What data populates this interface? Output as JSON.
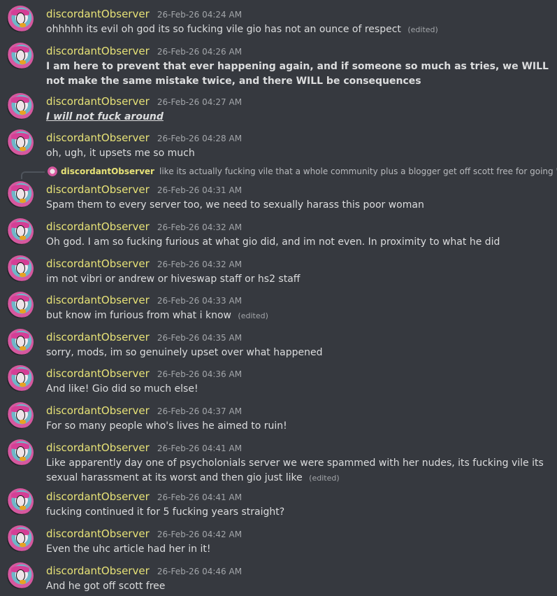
{
  "messages": [
    {
      "author": "discordantObserver",
      "time": "26-Feb-26 04:24 AM",
      "text": "ohhhhh its evil oh god its so fucking vile gio has  not an ounce of respect",
      "edited": "(edited)"
    },
    {
      "author": "discordantObserver",
      "time": "26-Feb-26 04:26 AM",
      "text": " I am here to prevent that ever happening again, and if someone so much as tries, we WILL not make the same mistake twice, and there WILL be consequences",
      "style": "bold"
    },
    {
      "author": "discordantObserver",
      "time": "26-Feb-26 04:27 AM",
      "text": "I will not fuck around",
      "style": "bold-italic-underline"
    },
    {
      "author": "discordantObserver",
      "time": "26-Feb-26 04:28 AM",
      "text": "oh, ugh, it upsets me so much"
    },
    {
      "author": "discordantObserver",
      "time": "26-Feb-26 04:31 AM",
      "text": "Spam them to every server too, we need to sexually harass this poor woman"
    },
    {
      "author": "discordantObserver",
      "time": "26-Feb-26 04:32 AM",
      "text": "Oh god. I am so fucking furious at what gio did, and im not even. In proximity to what he did"
    },
    {
      "author": "discordantObserver",
      "time": "26-Feb-26 04:32 AM",
      "text": "im not vibri or andrew or hiveswap staff or hs2 staff"
    },
    {
      "author": "discordantObserver",
      "time": "26-Feb-26 04:33 AM",
      "text": "but know im furious from what i know",
      "edited": "(edited)"
    },
    {
      "author": "discordantObserver",
      "time": "26-Feb-26 04:35 AM",
      "text": "sorry, mods, im so genuinely upset over what happened"
    },
    {
      "author": "discordantObserver",
      "time": "26-Feb-26 04:36 AM",
      "text": "And like! Gio did so much else!"
    },
    {
      "author": "discordantObserver",
      "time": "26-Feb-26 04:37 AM",
      "text": "For so many people who's lives he aimed to ruin!"
    },
    {
      "author": "discordantObserver",
      "time": "26-Feb-26 04:41 AM",
      "text": "Like apparently day one of psycholonials server we were spammed with her nudes, its fucking vile its sexual harassment at its worst and then gio just like",
      "edited": "(edited)"
    },
    {
      "author": "discordantObserver",
      "time": "26-Feb-26 04:41 AM",
      "text": "fucking continued it for 5 fucking years straight?"
    },
    {
      "author": "discordantObserver",
      "time": "26-Feb-26 04:42 AM",
      "text": "Even the uhc article had her in it!"
    },
    {
      "author": "discordantObserver",
      "time": "26-Feb-26 04:46 AM",
      "text": "And he got off scott free"
    }
  ],
  "reply": {
    "author": "discordantObserver",
    "text": "like its actually fucking vile that a whole community plus a blogger get off scott free for going \""
  },
  "colors": {
    "background": "#36393f",
    "username": "#e7e277",
    "timestamp": "#a3a6aa",
    "text": "#dcddde"
  }
}
